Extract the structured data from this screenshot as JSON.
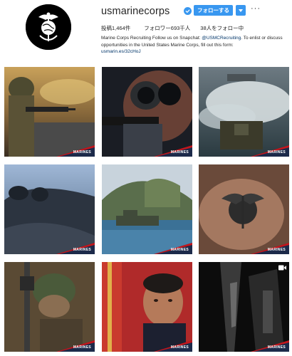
{
  "profile": {
    "username": "usmarinecorps",
    "follow_label": "フォローする",
    "more_label": "···",
    "stats": {
      "posts": "投稿1,464件",
      "followers": "フォロワー693千人",
      "following": "38人をフォロー中"
    },
    "bio": {
      "text_before": "Marine Corps Recruiting Follow us on Snapchat: ",
      "mention": "@USMCRecruiting",
      "text_after": ". To enlist or discuss opportunities in the United States Marine Corps, fill out this form:",
      "link": "usmarin.es/32cHoJ"
    }
  },
  "posts": [
    {
      "badge": "MARINES"
    },
    {
      "badge": "MARINES"
    },
    {
      "badge": "MARINES"
    },
    {
      "badge": "MARINES"
    },
    {
      "badge": "MARINES"
    },
    {
      "badge": "MARINES"
    },
    {
      "badge": "MARINES"
    },
    {
      "badge": "MARINES"
    },
    {
      "badge": "MARINES"
    }
  ],
  "colors": {
    "accent": "#3897f0",
    "badge_red": "#c4161c",
    "badge_navy": "#1c2a4a"
  },
  "icons": {
    "verified": "verified-badge-icon",
    "dropdown": "chevron-down-icon",
    "video": "video-camera-icon"
  }
}
